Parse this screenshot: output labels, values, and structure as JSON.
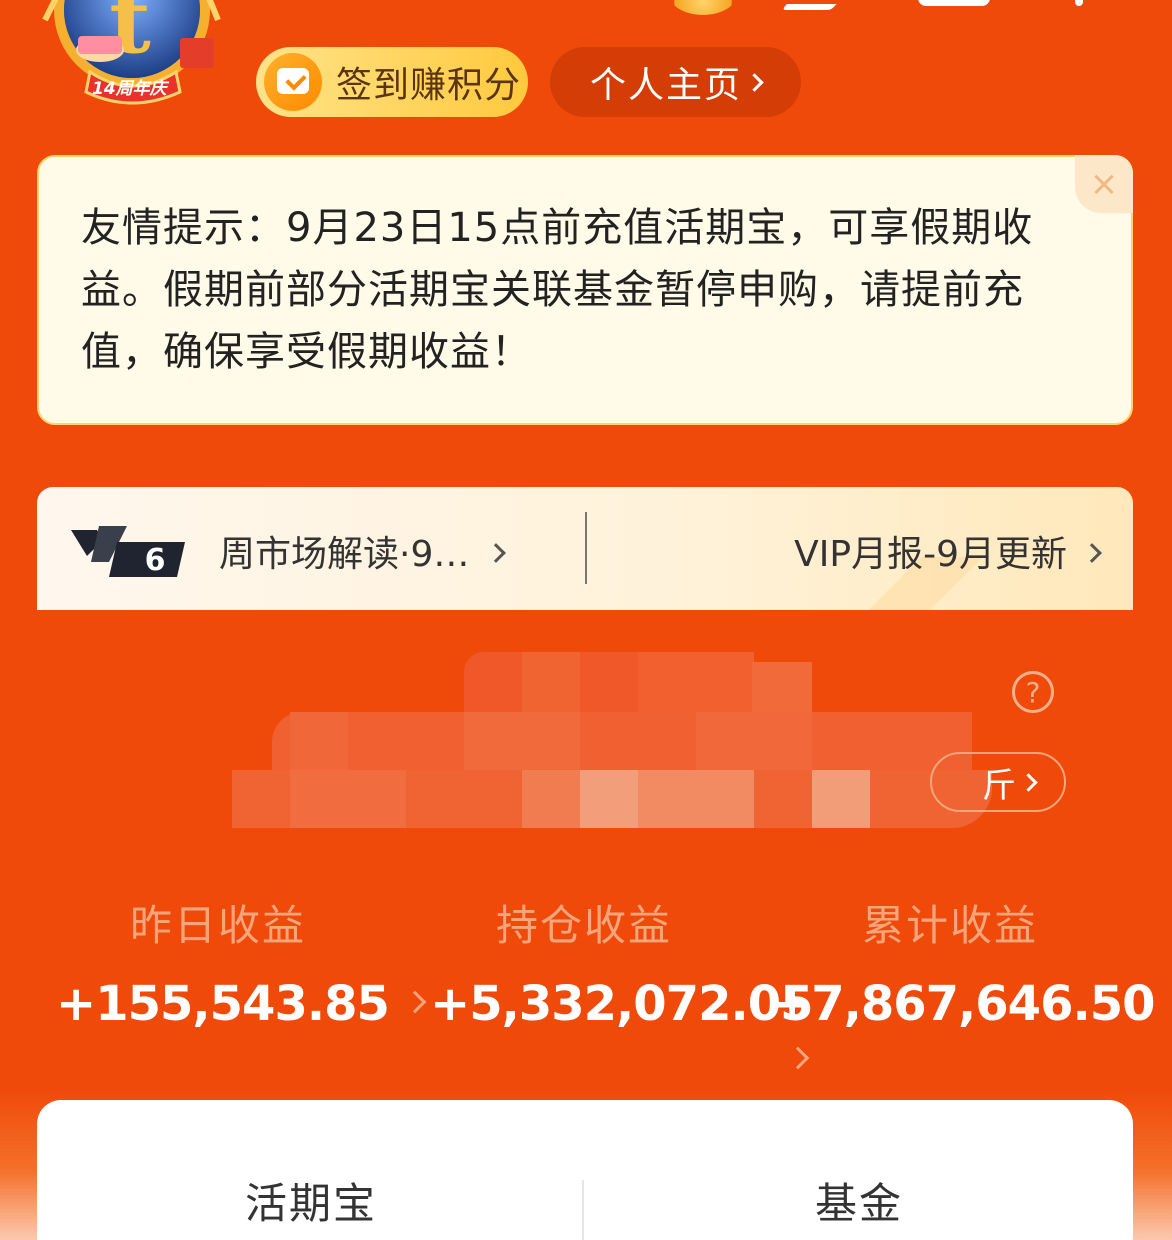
{
  "header": {
    "avatar_badge": "14周年庆",
    "checkin_label": "签到赚积分",
    "profile_label": "个人主页"
  },
  "notice": {
    "text": "友情提示：9月23日15点前充值活期宝，可享假期收益。假期前部分活期宝关联基金暂停申购，请提前充值，确保享受假期收益！",
    "close": "×"
  },
  "vip_banner": {
    "badge": "6",
    "weekly_read": "周市场解读·9…",
    "report": "VIP月报-9月更新"
  },
  "assets": {
    "help": "?",
    "detail_partial": "斤"
  },
  "stats": [
    {
      "label": "昨日收益",
      "value": "+155,543.85"
    },
    {
      "label": "持仓收益",
      "value": "+5,332,072.05"
    },
    {
      "label": "累计收益",
      "value": "+7,867,646.50"
    }
  ],
  "tabs": [
    {
      "label": "活期宝"
    },
    {
      "label": "基金"
    }
  ],
  "colors": {
    "primary": "#f04a0b",
    "notice_bg": "#fffbe8",
    "label": "#f9a57c"
  }
}
